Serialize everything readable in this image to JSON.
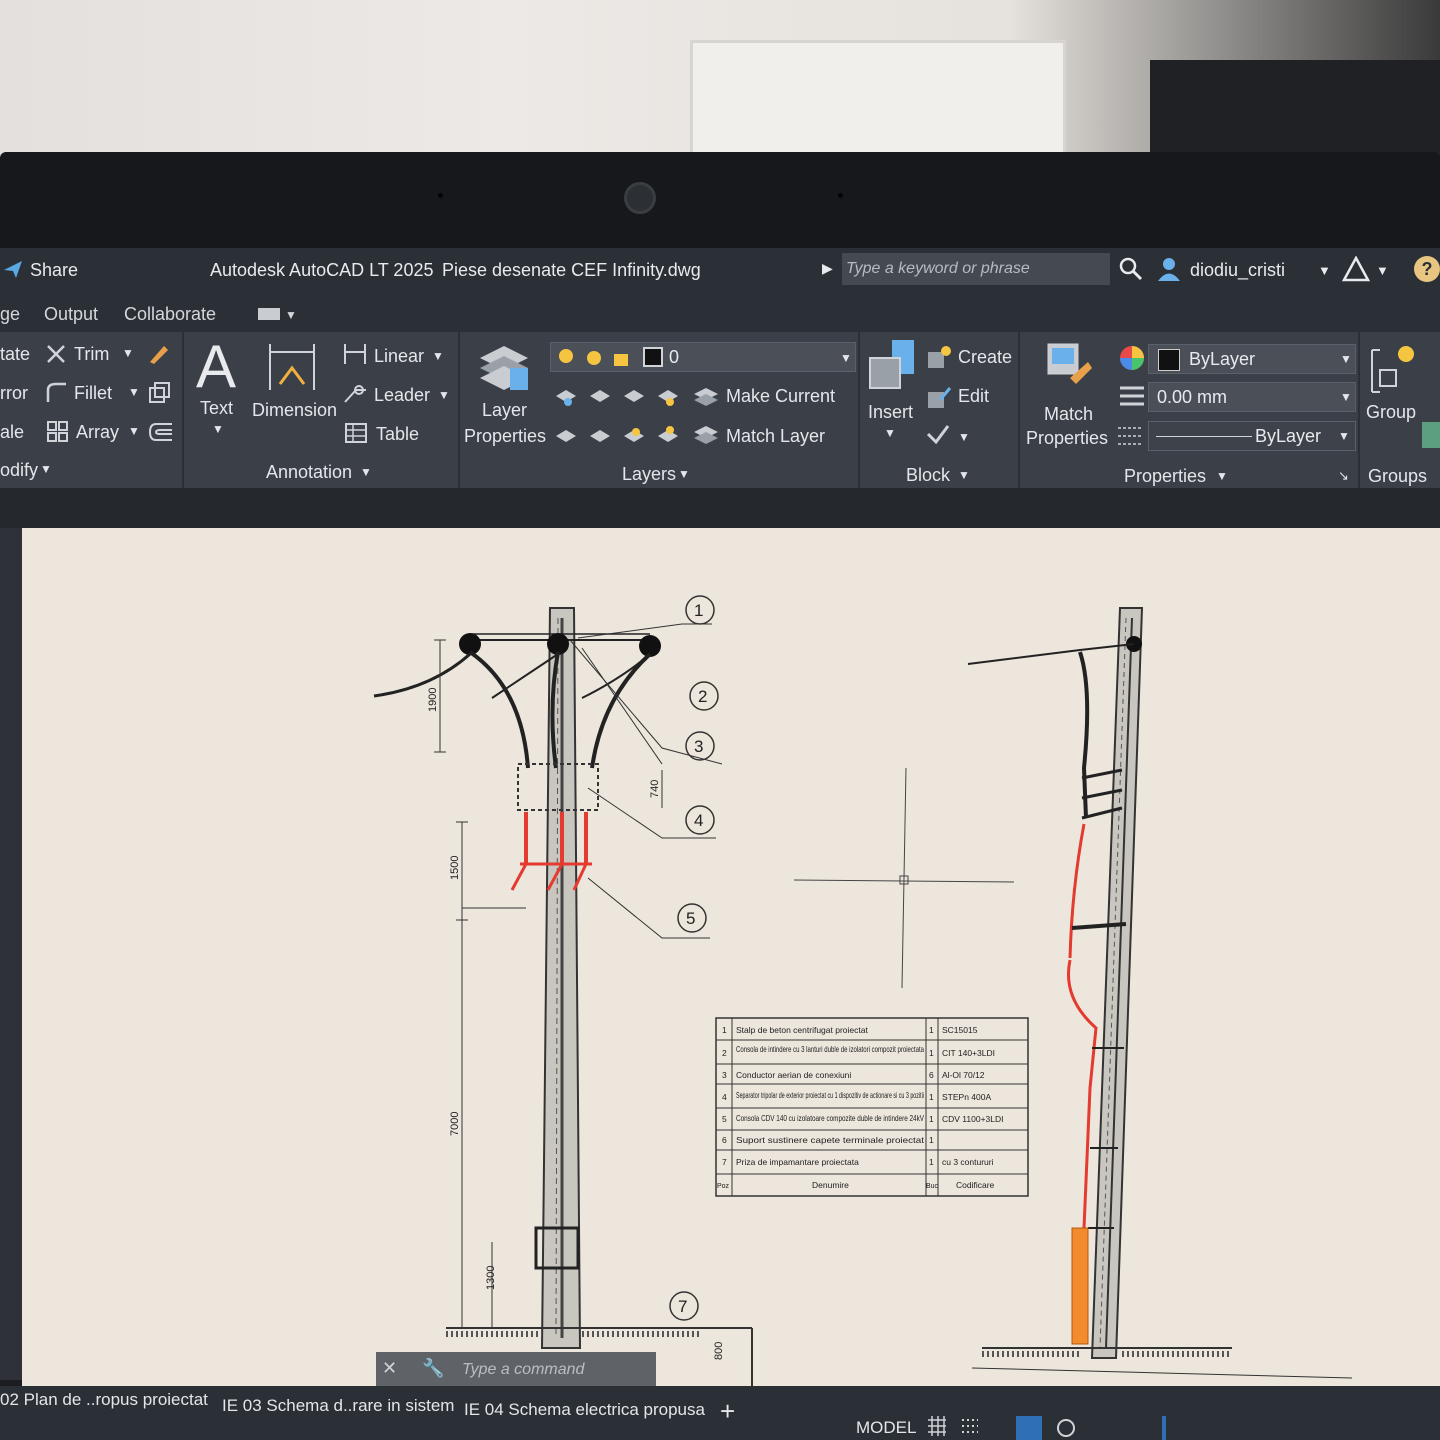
{
  "title_bar": {
    "share_label": "Share",
    "app_title": "Autodesk AutoCAD LT 2025",
    "file_name": "Piese desenate CEF Infinity.dwg",
    "search_placeholder": "Type a keyword or phrase",
    "user_name": "diodiu_cristi"
  },
  "ribbon_tabs": [
    "ge",
    "Output",
    "Collaborate"
  ],
  "ribbon": {
    "modify": {
      "items": [
        "tate",
        "Trim",
        "rror",
        "Fillet",
        "ale",
        "Array"
      ],
      "title": "odify"
    },
    "annotation": {
      "text_label": "Text",
      "dimension_label": "Dimension",
      "linear_label": "Linear",
      "leader_label": "Leader",
      "table_label": "Table",
      "title": "Annotation"
    },
    "layers": {
      "properties_label_1": "Layer",
      "properties_label_2": "Properties",
      "current_layer": "0",
      "make_current_label": "Make Current",
      "match_layer_label": "Match Layer",
      "title": "Layers"
    },
    "block": {
      "insert_label": "Insert",
      "create_label": "Create",
      "edit_label": "Edit",
      "title": "Block"
    },
    "properties": {
      "match_label_1": "Match",
      "match_label_2": "Properties",
      "color_value": "ByLayer",
      "lineweight_value": "0.00 mm",
      "linetype_value": "ByLayer",
      "title": "Properties"
    },
    "groups": {
      "group_label": "Group",
      "title": "Groups"
    }
  },
  "drawing": {
    "callouts": [
      "1",
      "2",
      "3",
      "4",
      "5",
      "7"
    ],
    "dimensions": [
      "1900",
      "740",
      "1500",
      "7000",
      "1300",
      "800"
    ],
    "bom_rows": [
      {
        "poz": "1",
        "denumire": "Stalp de beton centrifugat proiectat",
        "buc": "1",
        "codificare": "SC15015"
      },
      {
        "poz": "2",
        "denumire": "Consola de intindere cu 3 lanturi duble de izolatori compozit proiectata",
        "buc": "1",
        "codificare": "CIT 140+3LDI"
      },
      {
        "poz": "3",
        "denumire": "Conductor aerian de conexiuni",
        "buc": "6",
        "codificare": "Al-Ol 70/12"
      },
      {
        "poz": "4",
        "denumire": "Separator tripolar de exterior proiectat cu 1 dispozitiv de actionare si cu 3 pozitii",
        "buc": "1",
        "codificare": "STEPn 400A"
      },
      {
        "poz": "5",
        "denumire": "Consola CDV 140 cu izolatoare compozite duble de intindere 24kV",
        "buc": "1",
        "codificare": "CDV 1100+3LDI"
      },
      {
        "poz": "6",
        "denumire": "Suport sustinere capete terminale proiectat",
        "buc": "1",
        "codificare": ""
      },
      {
        "poz": "7",
        "denumire": "Priza de impamantare proiectata",
        "buc": "1",
        "codificare": "cu 3 contururi"
      }
    ],
    "bom_header": {
      "poz": "Poz",
      "denumire": "Denumire",
      "buc": "Buc",
      "codificare": "Codificare"
    }
  },
  "command_line": {
    "placeholder": "Type a command"
  },
  "layout_tabs": [
    "02 Plan de ..ropus proiectat",
    "IE 03 Schema d..rare in sistem",
    "IE 04 Schema electrica propusa"
  ],
  "status_bar": {
    "model_label": "MODEL"
  },
  "colors": {
    "ribbon_bg": "#3b4048",
    "canvas_bg": "#ece6dc",
    "red_wire": "#e53a2f",
    "orange_ground": "#f28a2e"
  }
}
